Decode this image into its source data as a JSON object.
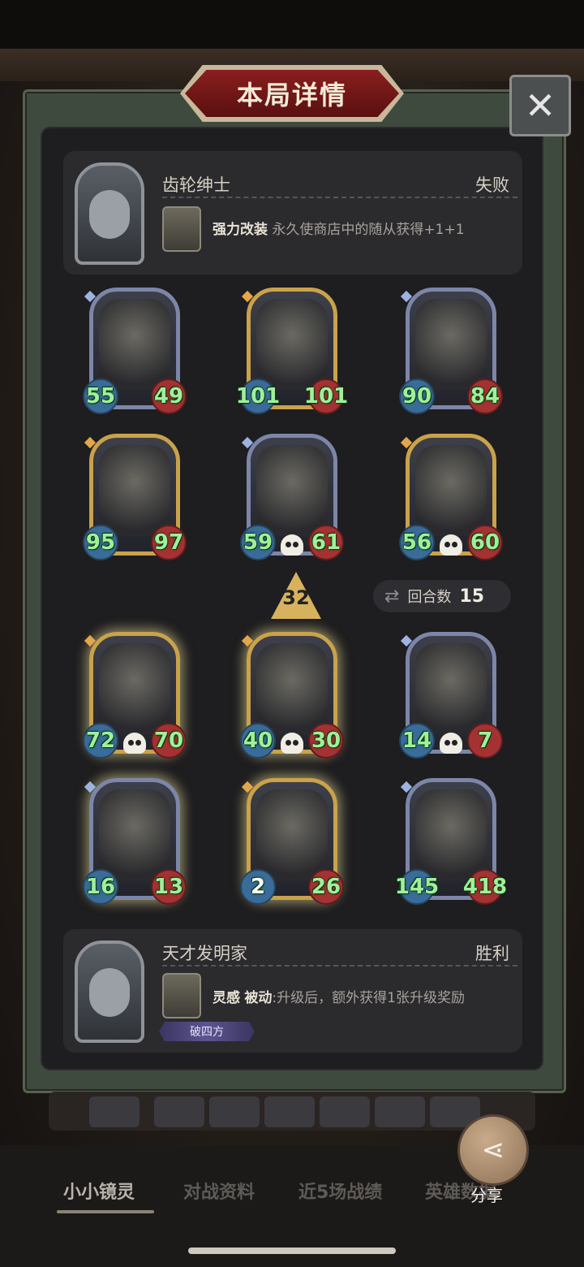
{
  "dialog": {
    "title": "本局详情",
    "close_icon": "✕"
  },
  "top_hero": {
    "name": "齿轮绅士",
    "result": "失败",
    "skill_name": "强力改装",
    "skill_desc": "永久使商店中的随从获得+1+1"
  },
  "bottom_hero": {
    "name": "天才发明家",
    "result": "胜利",
    "skill_name": "灵感",
    "skill_tag": "被动",
    "skill_desc": ":升级后，额外获得1张升级奖励",
    "badge": "破四方"
  },
  "top_board": [
    {
      "atk": "55",
      "hp": "49"
    },
    {
      "atk": "101",
      "hp": "101"
    },
    {
      "atk": "90",
      "hp": "84"
    },
    {
      "atk": "95",
      "hp": "97"
    },
    {
      "atk": "59",
      "hp": "61"
    },
    {
      "atk": "56",
      "hp": "60"
    }
  ],
  "bottom_board": [
    {
      "atk": "72",
      "hp": "70"
    },
    {
      "atk": "40",
      "hp": "30"
    },
    {
      "atk": "14",
      "hp": "7"
    },
    {
      "atk": "16",
      "hp": "13"
    },
    {
      "atk": "2",
      "hp": "26"
    },
    {
      "atk": "145",
      "hp": "418"
    }
  ],
  "level_marker": "32",
  "rounds": {
    "label": "回合数",
    "value": "15"
  },
  "tabs": [
    "小小镜灵",
    "对战资料",
    "近5场战绩",
    "英雄数据"
  ],
  "share": {
    "label": "分享"
  },
  "colors": {
    "atk_text": "#9ff09b",
    "atk_badge": "#3a6c9a",
    "hp_badge": "#a43232",
    "gold_frame": "#c9a24a",
    "silver_frame": "#7c86a8"
  }
}
